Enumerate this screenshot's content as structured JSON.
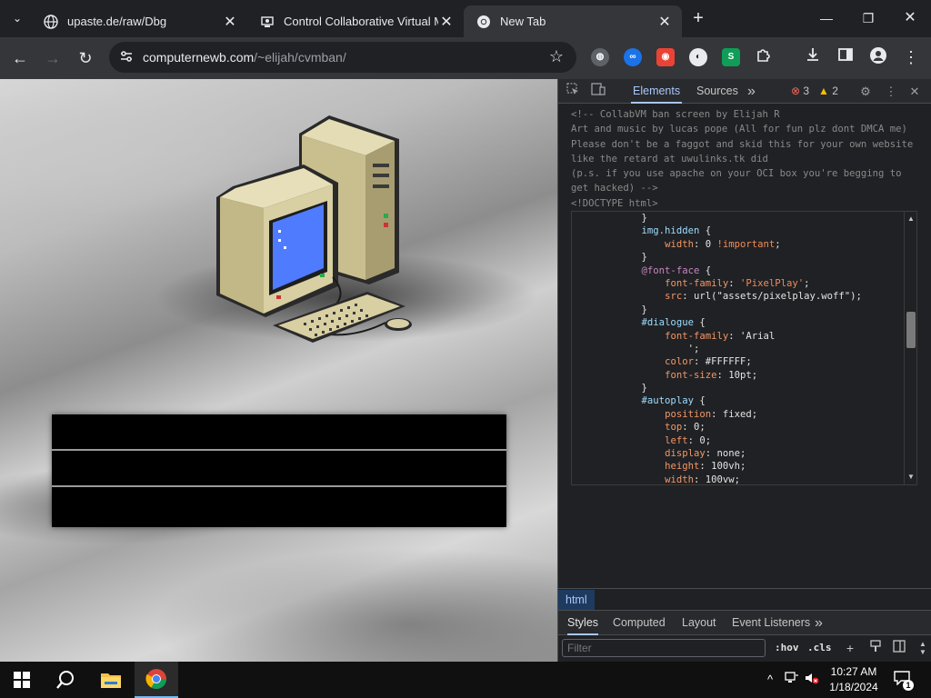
{
  "browser": {
    "tabs": [
      {
        "title": "upaste.de/raw/Dbg",
        "active": false
      },
      {
        "title": "Control Collaborative Virtual M",
        "active": false
      },
      {
        "title": "New Tab",
        "active": true
      }
    ],
    "new_tab_label": "+",
    "url_domain": "computernewb.com",
    "url_path": "/~elijah/cvmban/"
  },
  "page": {
    "dialog_rows": [
      "",
      "",
      ""
    ]
  },
  "devtools": {
    "tabs": [
      "Elements",
      "Sources"
    ],
    "more_tabs": "»",
    "error_count": "3",
    "warning_count": "2",
    "html_comment_lines": [
      "<!-- CollabVM ban screen by Elijah R",
      "Art and music by lucas pope (All for fun plz dont DMCA me)",
      "Please don't be a faggot and skid this for your own website",
      "like the retard at uwulinks.tk did",
      "(p.s. if you use apache on your OCI box you're begging to",
      "get hacked) -->",
      "<!DOCTYPE html>"
    ],
    "style_lines": [
      {
        "indent": 12,
        "parts": [
          {
            "t": "}",
            "c": "val"
          }
        ]
      },
      {
        "indent": 12,
        "parts": [
          {
            "t": "img.hidden",
            "c": "sel"
          },
          {
            "t": " {",
            "c": "val"
          }
        ]
      },
      {
        "indent": 16,
        "parts": [
          {
            "t": "width",
            "c": "prop"
          },
          {
            "t": ": 0 ",
            "c": "val"
          },
          {
            "t": "!important",
            "c": "imp"
          },
          {
            "t": ";",
            "c": "val"
          }
        ]
      },
      {
        "indent": 12,
        "parts": [
          {
            "t": "}",
            "c": "val"
          }
        ]
      },
      {
        "indent": 12,
        "parts": [
          {
            "t": "@font-face",
            "c": "at"
          },
          {
            "t": " {",
            "c": "val"
          }
        ]
      },
      {
        "indent": 16,
        "parts": [
          {
            "t": "font-family",
            "c": "prop"
          },
          {
            "t": ": ",
            "c": "val"
          },
          {
            "t": "'PixelPlay'",
            "c": "str"
          },
          {
            "t": ";",
            "c": "val"
          }
        ]
      },
      {
        "indent": 16,
        "parts": [
          {
            "t": "src",
            "c": "prop"
          },
          {
            "t": ": url(\"assets/pixelplay.woff\");",
            "c": "val"
          }
        ]
      },
      {
        "indent": 12,
        "parts": [
          {
            "t": "}",
            "c": "val"
          }
        ]
      },
      {
        "indent": 12,
        "parts": [
          {
            "t": "#dialogue",
            "c": "sel"
          },
          {
            "t": " {",
            "c": "val"
          }
        ]
      },
      {
        "indent": 16,
        "parts": [
          {
            "t": "font-family",
            "c": "prop"
          },
          {
            "t": ": 'Arial",
            "c": "val"
          }
        ]
      },
      {
        "indent": 20,
        "parts": [
          {
            "t": "';",
            "c": "val"
          }
        ]
      },
      {
        "indent": 16,
        "parts": [
          {
            "t": "color",
            "c": "prop"
          },
          {
            "t": ": #FFFFFF;",
            "c": "val"
          }
        ]
      },
      {
        "indent": 16,
        "parts": [
          {
            "t": "font-size",
            "c": "prop"
          },
          {
            "t": ": 10pt;",
            "c": "val"
          }
        ]
      },
      {
        "indent": 12,
        "parts": [
          {
            "t": "}",
            "c": "val"
          }
        ]
      },
      {
        "indent": 12,
        "parts": [
          {
            "t": "#autoplay",
            "c": "sel"
          },
          {
            "t": " {",
            "c": "val"
          }
        ]
      },
      {
        "indent": 16,
        "parts": [
          {
            "t": "position",
            "c": "prop"
          },
          {
            "t": ": fixed;",
            "c": "val"
          }
        ]
      },
      {
        "indent": 16,
        "parts": [
          {
            "t": "top",
            "c": "prop"
          },
          {
            "t": ": 0;",
            "c": "val"
          }
        ]
      },
      {
        "indent": 16,
        "parts": [
          {
            "t": "left",
            "c": "prop"
          },
          {
            "t": ": 0;",
            "c": "val"
          }
        ]
      },
      {
        "indent": 16,
        "parts": [
          {
            "t": "display",
            "c": "prop"
          },
          {
            "t": ": none;",
            "c": "val"
          }
        ]
      },
      {
        "indent": 16,
        "parts": [
          {
            "t": "height",
            "c": "prop"
          },
          {
            "t": ": 100vh;",
            "c": "val"
          }
        ]
      },
      {
        "indent": 16,
        "parts": [
          {
            "t": "width",
            "c": "prop"
          },
          {
            "t": ": 100vw;",
            "c": "val"
          }
        ]
      }
    ],
    "breadcrumb": "html",
    "styles_tabs": [
      "Styles",
      "Computed",
      "Layout",
      "Event Listeners"
    ],
    "styles_more": "»",
    "filter_placeholder": "Filter",
    "hov_label": ":hov",
    "cls_label": ".cls"
  },
  "taskbar": {
    "time": "10:27 AM",
    "date": "1/18/2024",
    "notification_count": "1"
  },
  "colors": {
    "accent": "#a8c7fa",
    "error": "#ee675c",
    "warning": "#fbbc04"
  }
}
